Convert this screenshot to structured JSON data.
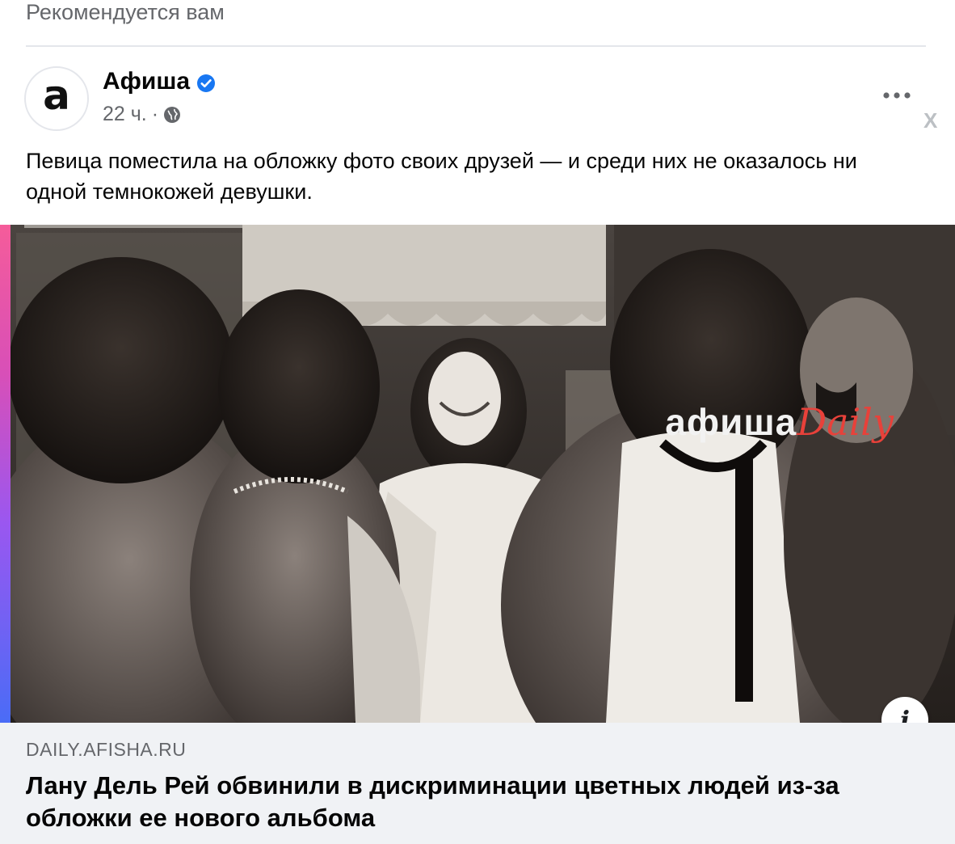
{
  "feed": {
    "section_label": "Рекомендуется вам"
  },
  "post": {
    "avatar_glyph": "a",
    "page_name": "Афиша",
    "verified_icon": "verified-badge-icon",
    "time": "22 ч.",
    "separator": "·",
    "audience_icon": "globe-icon",
    "more_icon": "ellipsis-icon",
    "close_label": "X",
    "text": "Певица поместила на обложку фото своих друзей — и среди них не оказалось ни одной темнокожей девушки."
  },
  "link_preview": {
    "watermark_main": "афиша",
    "watermark_accent": "Daily",
    "info_label": "i",
    "domain": "DAILY.AFISHA.RU",
    "title": "Лану Дель Рей обвинили в дискриминации цветных людей из-за обложки ее нового альбома"
  },
  "colors": {
    "brand_blue": "#1877f2",
    "secondary_text": "#65676b",
    "preview_bg": "#f0f2f5",
    "watermark_red": "#e8413a"
  }
}
